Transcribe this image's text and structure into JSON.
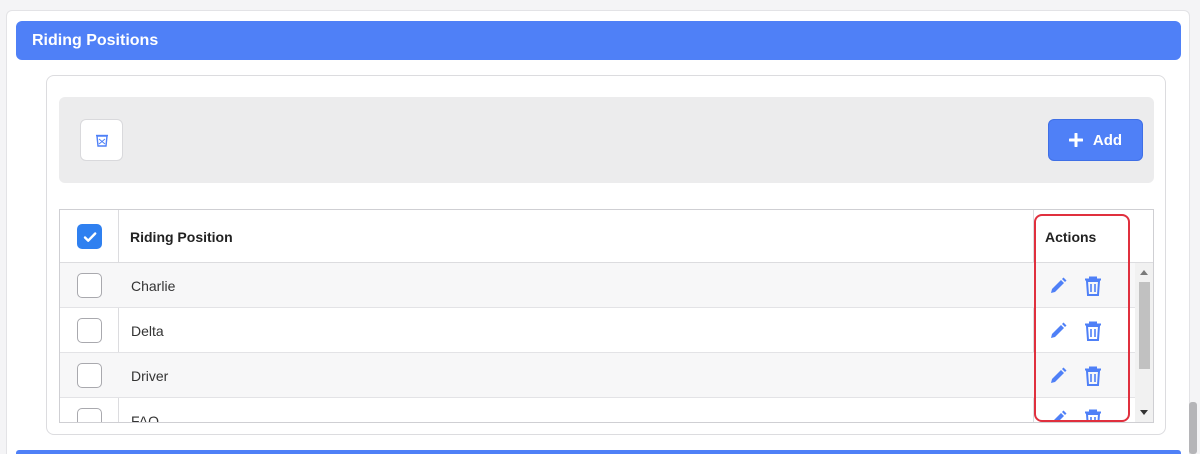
{
  "section": {
    "title": "Riding Positions"
  },
  "toolbar": {
    "add_label": "Add"
  },
  "grid": {
    "header_checked": true,
    "columns": {
      "name": "Riding Position",
      "actions": "Actions"
    },
    "rows": [
      {
        "name": "Charlie",
        "checked": false
      },
      {
        "name": "Delta",
        "checked": false
      },
      {
        "name": "Driver",
        "checked": false
      },
      {
        "name": "FAO",
        "checked": false
      }
    ]
  },
  "icons": {
    "bulk_delete": "trash-icon",
    "add": "plus-icon",
    "edit": "pencil-icon",
    "delete": "trash-icon",
    "check": "check-icon"
  },
  "colors": {
    "primary": "#4f80f7",
    "checkbox_checked": "#2f80f0",
    "highlight": "#e0303e"
  }
}
